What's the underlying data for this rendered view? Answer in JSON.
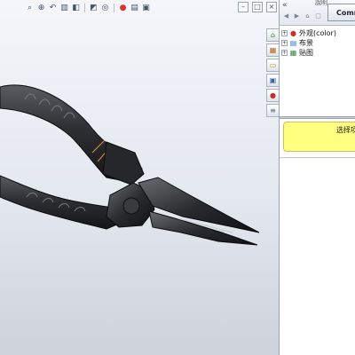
{
  "toolbar": {
    "icons": [
      "zoom-to-fit-icon",
      "zoom-area-icon",
      "previous-view-icon",
      "section-view-icon",
      "view-orientation-icon",
      "display-style-icon",
      "hide-show-icon",
      "edit-appearance-icon",
      "apply-scene-icon",
      "view-settings-icon"
    ]
  },
  "panel": {
    "title": "說明",
    "collapse_glyph": "«",
    "command_button_label": "Comma",
    "tree": [
      {
        "label": "外观(color)",
        "icon": "appearance-icon"
      },
      {
        "label": "布景",
        "icon": "scene-icon"
      },
      {
        "label": "贴图",
        "icon": "decal-icon"
      }
    ],
    "message": "选择项目"
  },
  "task_pane_tabs": [
    "solidworks-resources-icon",
    "design-library-icon",
    "file-explorer-icon",
    "view-palette-icon",
    "appearances-icon",
    "custom-properties-icon"
  ],
  "colors": {
    "message_bg": "#ffff80",
    "model_body": "#2b2c2f",
    "highlight_edge": "#e0902a"
  }
}
